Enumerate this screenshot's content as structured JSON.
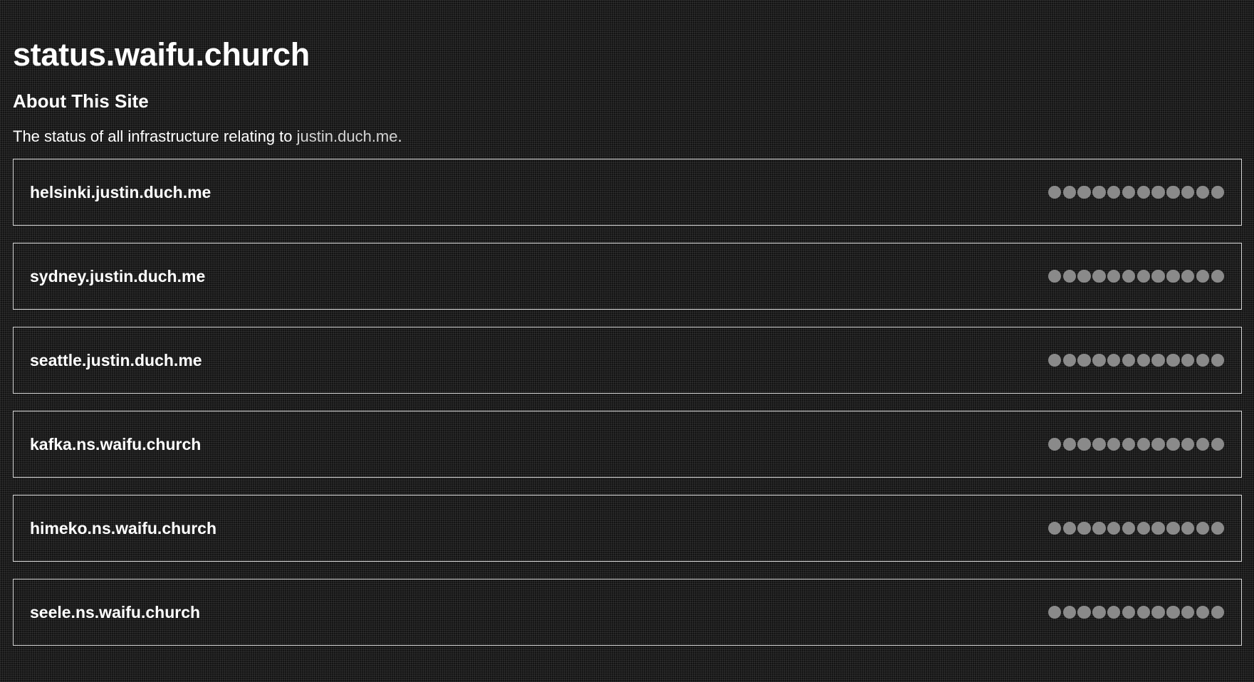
{
  "header": {
    "title": "status.waifu.church"
  },
  "about": {
    "heading": "About This Site",
    "text_prefix": "The status of all infrastructure relating to ",
    "link_text": "justin.duch.me",
    "text_suffix": "."
  },
  "colors": {
    "background": "#141414",
    "text": "#ffffff",
    "card_border": "#d9d9d9",
    "status_dot": "#8a8a8a",
    "link": "#d4d4d4"
  },
  "hosts": [
    {
      "name": "helsinki.justin.duch.me",
      "checks": 12
    },
    {
      "name": "sydney.justin.duch.me",
      "checks": 12
    },
    {
      "name": "seattle.justin.duch.me",
      "checks": 12
    },
    {
      "name": "kafka.ns.waifu.church",
      "checks": 12
    },
    {
      "name": "himeko.ns.waifu.church",
      "checks": 12
    },
    {
      "name": "seele.ns.waifu.church",
      "checks": 12
    }
  ]
}
